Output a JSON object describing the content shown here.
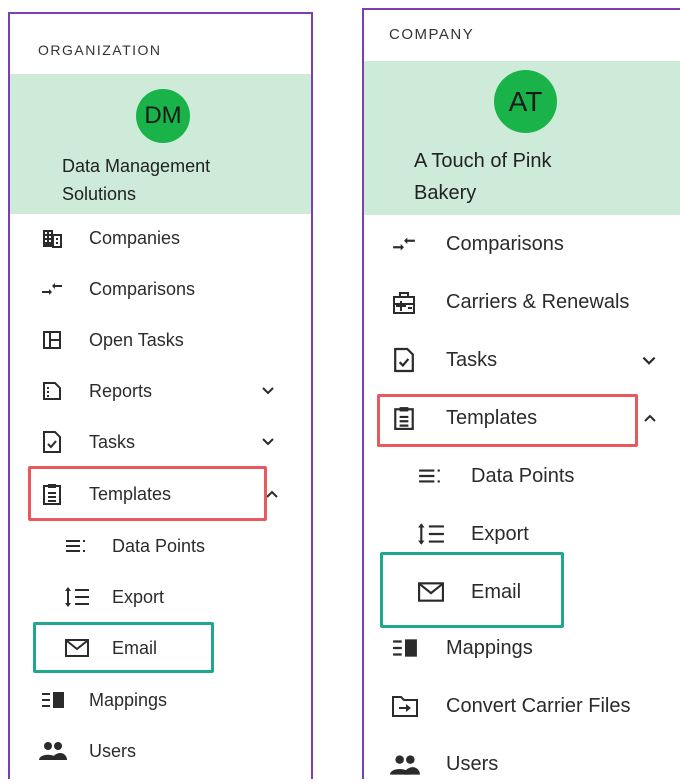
{
  "left": {
    "section_label": "ORGANIZATION",
    "avatar_initials": "DM",
    "org_name_line1": "Data Management",
    "org_name_line2": "Solutions",
    "items": [
      {
        "label": "Companies",
        "icon": "building-icon"
      },
      {
        "label": "Comparisons",
        "icon": "compare-arrows-icon"
      },
      {
        "label": "Open Tasks",
        "icon": "layout-icon"
      },
      {
        "label": "Reports",
        "icon": "report-icon"
      },
      {
        "label": "Tasks",
        "icon": "task-check-icon"
      },
      {
        "label": "Templates",
        "icon": "clipboard-icon"
      },
      {
        "label": "Data Points",
        "icon": "data-points-icon"
      },
      {
        "label": "Export",
        "icon": "export-icon"
      },
      {
        "label": "Email",
        "icon": "envelope-icon"
      },
      {
        "label": "Mappings",
        "icon": "mappings-icon"
      },
      {
        "label": "Users",
        "icon": "users-icon"
      }
    ]
  },
  "right": {
    "section_label": "COMPANY",
    "avatar_initials": "AT",
    "org_name_line1": "A Touch of Pink",
    "org_name_line2": "Bakery",
    "items": [
      {
        "label": "Comparisons",
        "icon": "compare-arrows-icon"
      },
      {
        "label": "Carriers & Renewals",
        "icon": "medical-kit-icon"
      },
      {
        "label": "Tasks",
        "icon": "task-check-icon"
      },
      {
        "label": "Templates",
        "icon": "clipboard-icon"
      },
      {
        "label": "Data Points",
        "icon": "data-points-icon"
      },
      {
        "label": "Export",
        "icon": "export-icon"
      },
      {
        "label": "Email",
        "icon": "envelope-icon"
      },
      {
        "label": "Mappings",
        "icon": "mappings-icon"
      },
      {
        "label": "Convert Carrier Files",
        "icon": "folder-arrow-icon"
      },
      {
        "label": "Users",
        "icon": "users-icon"
      }
    ]
  },
  "colors": {
    "panel_border": "#7b3fb0",
    "org_card_bg": "#cdebd8",
    "avatar_bg": "#19b34a",
    "highlight_red": "#e8585c",
    "highlight_teal": "#1fa88e"
  }
}
